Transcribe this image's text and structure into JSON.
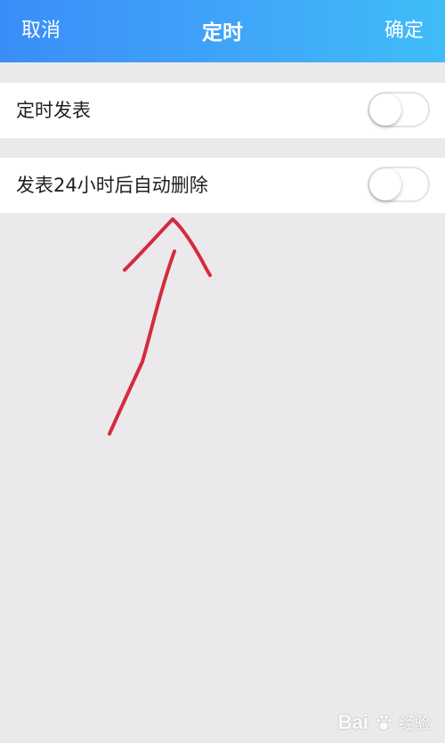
{
  "navbar": {
    "cancel_label": "取消",
    "title": "定时",
    "confirm_label": "确定"
  },
  "settings": [
    {
      "label": "定时发表",
      "enabled": false
    },
    {
      "label": "发表24小时后自动删除",
      "enabled": false
    }
  ],
  "annotation": {
    "type": "hand-drawn-arrow",
    "color": "#d42b3f"
  },
  "watermark": {
    "logo_text": "Bai",
    "site_text": "经验"
  },
  "colors": {
    "navbar_start": "#3a8df8",
    "navbar_end": "#3fbdf8",
    "background": "#ebe9ec",
    "row_background": "#ffffff"
  }
}
